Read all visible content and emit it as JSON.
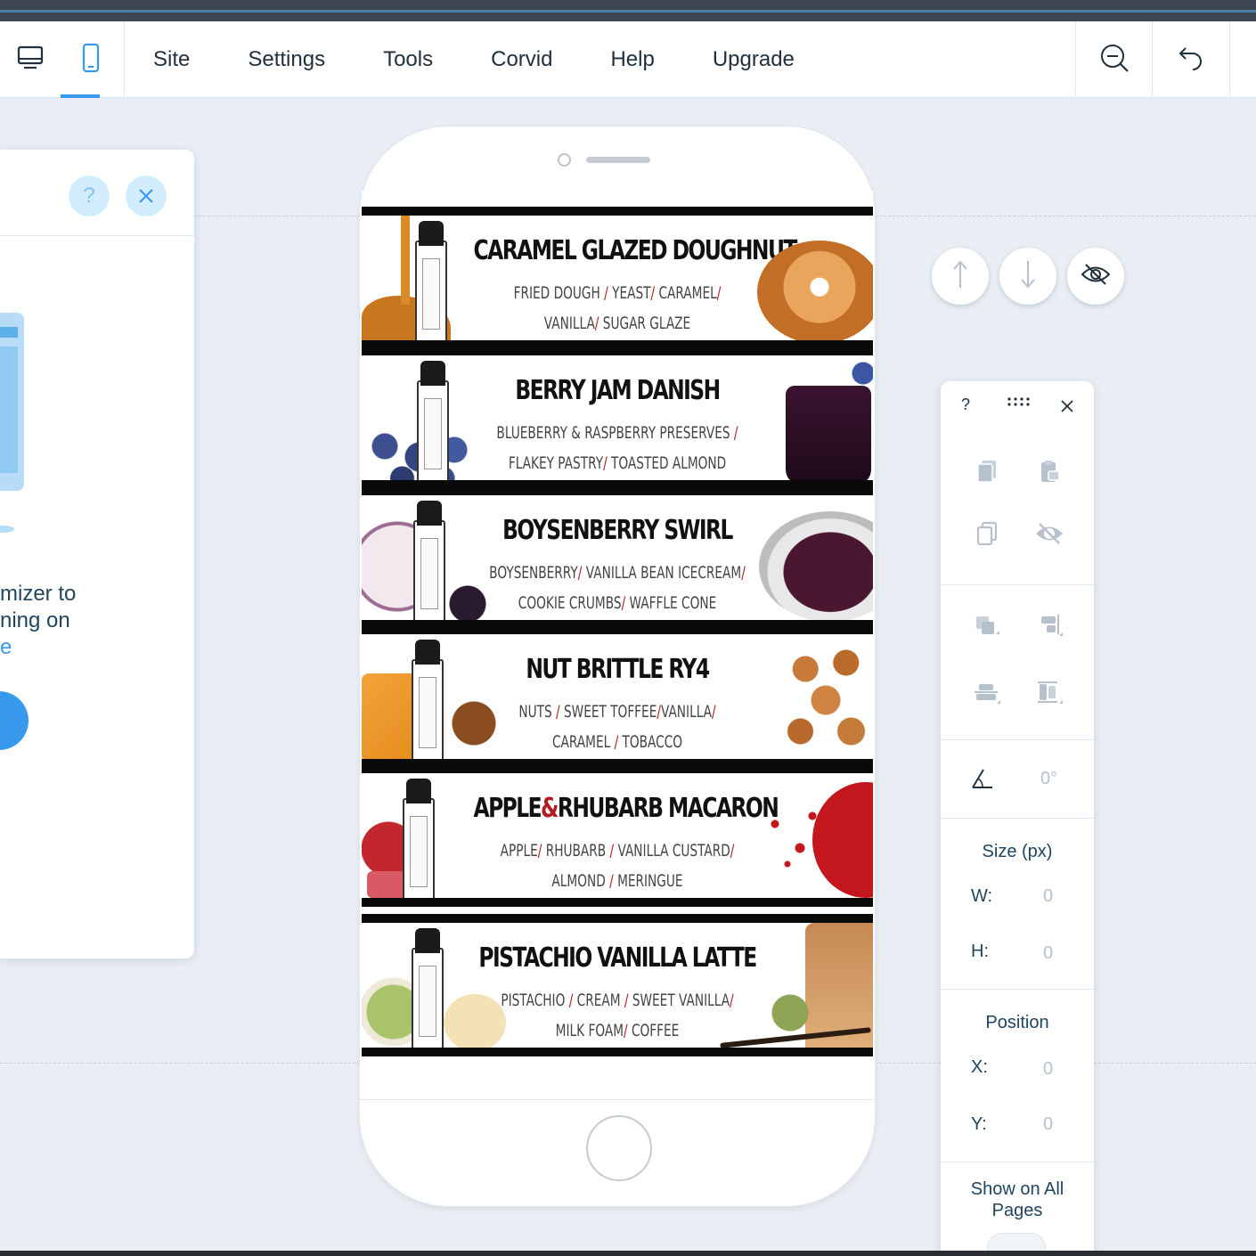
{
  "topbar": {
    "menu": [
      "Site",
      "Settings",
      "Tools",
      "Corvid",
      "Help",
      "Upgrade"
    ]
  },
  "left_panel": {
    "text_line1": "mizer to",
    "text_line2": "ning on",
    "text_line3": "e"
  },
  "banners": [
    {
      "title_parts": [
        "CARAMEL GLAZED DOUGHNUT"
      ],
      "line1": [
        "FRIED DOUGH",
        "YEAST",
        "CARAMEL",
        ""
      ],
      "line2": [
        "VANILLA",
        "SUGAR GLAZE"
      ],
      "band_color": "#c98a2e"
    },
    {
      "title_parts": [
        "BERRY JAM DANISH"
      ],
      "line1": [
        "BLUEBERRY & RASPBERRY PRESERVES",
        ""
      ],
      "line2": [
        "FLAKEY PASTRY",
        "TOASTED ALMOND"
      ],
      "band_color": "#4aa3d8"
    },
    {
      "title_parts": [
        "BOYSENBERRY SWIRL"
      ],
      "line1": [
        "BOYSENBERRY",
        "VANILLA BEAN ICECREAM",
        ""
      ],
      "line2": [
        "COOKIE CRUMBS",
        "WAFFLE CONE"
      ],
      "band_color": "#7a3e8e"
    },
    {
      "title_parts": [
        "NUT BRITTLE RY4"
      ],
      "line1": [
        "NUTS",
        "SWEET TOFFEE",
        "VANILLA",
        ""
      ],
      "line2": [
        "CARAMEL",
        "TOBACCO"
      ],
      "band_color": "#d8b43a"
    },
    {
      "title_parts": [
        "APPLE",
        "&",
        "RHUBARB MACARON"
      ],
      "line1": [
        "APPLE",
        "RHUBARB",
        "VANILLA CUSTARD",
        ""
      ],
      "line2": [
        "ALMOND",
        "MERINGUE"
      ],
      "band_color": "#b8222a"
    },
    {
      "title_parts": [
        "PISTACHIO VANILLA LATTE"
      ],
      "line1": [
        "PISTACHIO",
        "CREAM",
        "SWEET VANILLA",
        ""
      ],
      "line2": [
        "MILK FOAM",
        "COFFEE"
      ],
      "band_color": "#8db84a"
    }
  ],
  "inspector": {
    "help": "?",
    "rotation_value": "0°",
    "size_title": "Size (px)",
    "w_label": "W:",
    "w_value": "0",
    "h_label": "H:",
    "h_value": "0",
    "position_title": "Position",
    "x_label": "X:",
    "x_value": "0",
    "y_label": "Y:",
    "y_value": "0",
    "show_all_line1": "Show on All",
    "show_all_line2": "Pages"
  },
  "colors": {
    "accent": "#3899ec",
    "brand_red": "#b01c22"
  }
}
